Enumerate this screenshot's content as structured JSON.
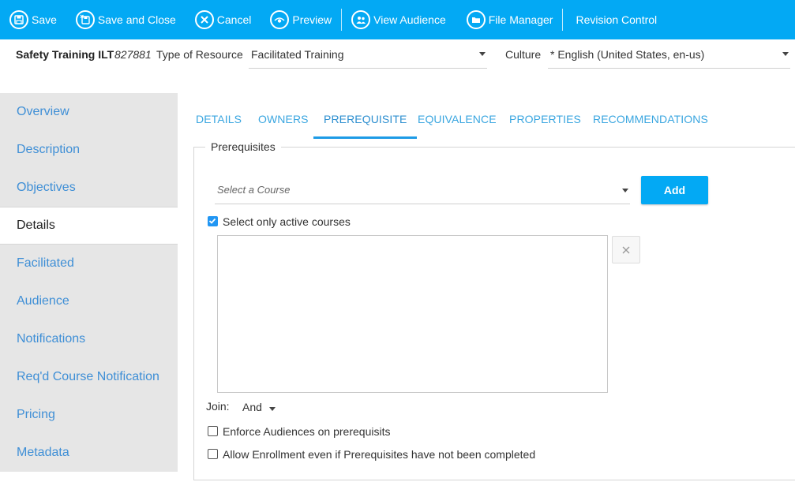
{
  "toolbar": {
    "save": {
      "label": "Save",
      "icon": "save-icon"
    },
    "save_close": {
      "label": "Save and Close",
      "icon": "save-close-icon"
    },
    "cancel": {
      "label": "Cancel",
      "icon": "cancel-icon"
    },
    "preview": {
      "label": "Preview",
      "icon": "preview-icon"
    },
    "view_audience": {
      "label": "View Audience",
      "icon": "audience-icon"
    },
    "file_manager": {
      "label": "File Manager",
      "icon": "folder-icon"
    },
    "revision_control": {
      "label": "Revision Control"
    }
  },
  "header": {
    "title": "Safety Training ILT",
    "id": "827881",
    "type_label": "Type of Resource",
    "type_value": "Facilitated Training",
    "culture_label": "Culture",
    "culture_value": "* English (United States, en-us)"
  },
  "sidebar": {
    "items": [
      {
        "label": "Overview",
        "active": false
      },
      {
        "label": "Description",
        "active": false
      },
      {
        "label": "Objectives",
        "active": false
      },
      {
        "label": "Details",
        "active": true
      },
      {
        "label": "Facilitated",
        "active": false
      },
      {
        "label": "Audience",
        "active": false
      },
      {
        "label": "Notifications",
        "active": false
      },
      {
        "label": "Req'd Course Notification",
        "active": false
      },
      {
        "label": "Pricing",
        "active": false
      },
      {
        "label": "Metadata",
        "active": false
      }
    ]
  },
  "tabs": [
    {
      "label": "DETAILS",
      "active": false
    },
    {
      "label": "OWNERS",
      "active": false
    },
    {
      "label": "PREREQUISITE",
      "active": true
    },
    {
      "label": "EQUIVALENCE",
      "active": false
    },
    {
      "label": "PROPERTIES",
      "active": false
    },
    {
      "label": "RECOMMENDATIONS",
      "active": false
    }
  ],
  "prerequisites": {
    "legend": "Prerequisites",
    "course_placeholder": "Select a Course",
    "add_label": "Add",
    "active_only": {
      "label": "Select only active courses",
      "checked": true
    },
    "selected_courses": [],
    "join_label": "Join:",
    "join_value": "And",
    "enforce_audiences": {
      "label": "Enforce Audiences on prerequisits",
      "checked": false
    },
    "allow_enrollment": {
      "label": "Allow Enrollment even if Prerequisites have not been completed",
      "checked": false
    }
  },
  "colors": {
    "brand": "#03a9f4",
    "link": "#3f8fd6",
    "tab": "#3aa6e0",
    "checkbox_checked": "#2196f3"
  }
}
